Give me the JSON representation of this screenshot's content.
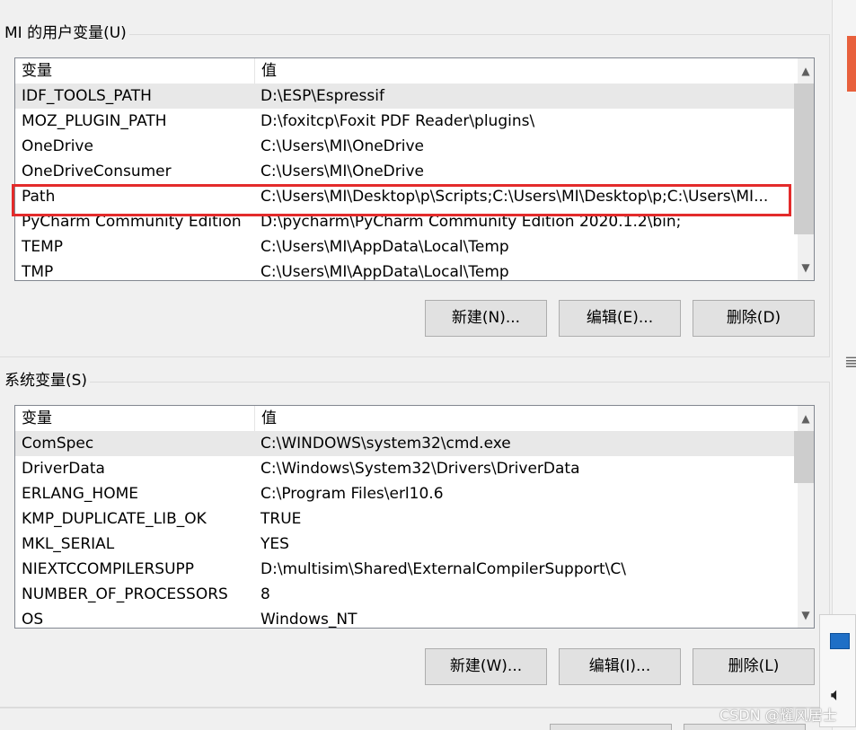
{
  "user_vars": {
    "title": "MI 的用户变量(U)",
    "col_name": "变量",
    "col_value": "值",
    "rows": [
      {
        "name": "IDF_TOOLS_PATH",
        "value": "D:\\ESP\\Espressif"
      },
      {
        "name": "MOZ_PLUGIN_PATH",
        "value": "D:\\foxitcp\\Foxit PDF Reader\\plugins\\"
      },
      {
        "name": "OneDrive",
        "value": "C:\\Users\\MI\\OneDrive"
      },
      {
        "name": "OneDriveConsumer",
        "value": "C:\\Users\\MI\\OneDrive"
      },
      {
        "name": "Path",
        "value": "C:\\Users\\MI\\Desktop\\p\\Scripts;C:\\Users\\MI\\Desktop\\p;C:\\Users\\MI..."
      },
      {
        "name": "PyCharm Community Edition",
        "value": "D:\\pycharm\\PyCharm Community Edition 2020.1.2\\bin;"
      },
      {
        "name": "TEMP",
        "value": "C:\\Users\\MI\\AppData\\Local\\Temp"
      },
      {
        "name": "TMP",
        "value": "C:\\Users\\MI\\AppData\\Local\\Temp"
      }
    ],
    "buttons": {
      "new": "新建(N)...",
      "edit": "编辑(E)...",
      "delete": "删除(D)"
    }
  },
  "system_vars": {
    "title": "系统变量(S)",
    "col_name": "变量",
    "col_value": "值",
    "rows": [
      {
        "name": "ComSpec",
        "value": "C:\\WINDOWS\\system32\\cmd.exe"
      },
      {
        "name": "DriverData",
        "value": "C:\\Windows\\System32\\Drivers\\DriverData"
      },
      {
        "name": "ERLANG_HOME",
        "value": "C:\\Program Files\\erl10.6"
      },
      {
        "name": "KMP_DUPLICATE_LIB_OK",
        "value": "TRUE"
      },
      {
        "name": "MKL_SERIAL",
        "value": "YES"
      },
      {
        "name": "NIEXTCCOMPILERSUPP",
        "value": "D:\\multisim\\Shared\\ExternalCompilerSupport\\C\\"
      },
      {
        "name": "NUMBER_OF_PROCESSORS",
        "value": "8"
      },
      {
        "name": "OS",
        "value": "Windows_NT"
      }
    ],
    "buttons": {
      "new": "新建(W)...",
      "edit": "编辑(I)...",
      "delete": "删除(L)"
    }
  },
  "scroll": {
    "up": "▲",
    "down": "▼"
  },
  "watermark": "CSDN @耀风居士",
  "colors": {
    "highlight": "#e32b2b",
    "selected_row": "#e8e8e8",
    "accent": "#e8603c"
  }
}
